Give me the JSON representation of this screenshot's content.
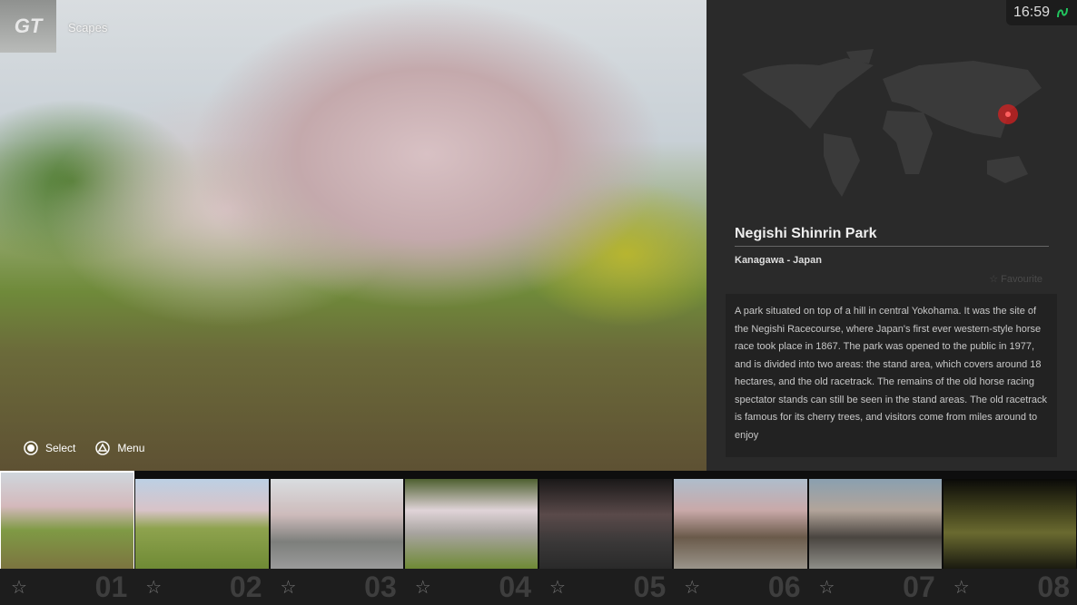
{
  "header": {
    "section": "Scapes",
    "logo": "GT",
    "clock": "16:59",
    "network_icon": "psn-connection-icon",
    "network_color": "#22c55e"
  },
  "hints": [
    {
      "icon": "circle-button-icon",
      "label": "Select"
    },
    {
      "icon": "triangle-button-icon",
      "label": "Menu"
    }
  ],
  "location": {
    "title": "Negishi Shinrin Park",
    "region": "Kanagawa - Japan",
    "favourite_label": "Favourite",
    "marker_color": "#e02020",
    "description": "A park situated on top of a hill in central Yokohama. It was the site of the Negishi Racecourse, where Japan's first ever western-style horse race took place in 1867. The park was opened to the public in 1977, and is divided into two areas: the stand area, which covers around 18 hectares, and the old racetrack. The remains of the old horse racing spectator stands can still be seen in the stand areas. The old racetrack is famous for its cherry trees, and visitors come from miles around to enjoy"
  },
  "thumbnails": [
    {
      "num": "01",
      "selected": true
    },
    {
      "num": "02"
    },
    {
      "num": "03"
    },
    {
      "num": "04"
    },
    {
      "num": "05"
    },
    {
      "num": "06"
    },
    {
      "num": "07"
    },
    {
      "num": "08"
    }
  ]
}
